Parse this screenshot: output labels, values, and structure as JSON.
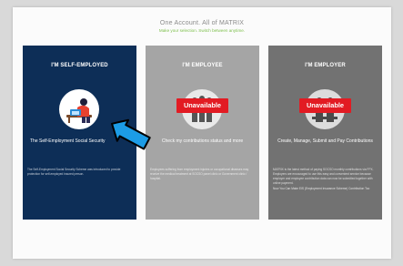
{
  "header": {
    "title": "One Account. All of MATRIX",
    "subtitle": "Make your selection. Switch between anytime."
  },
  "cards": [
    {
      "heading": "I'M SELF-EMPLOYED",
      "title": "The Self-Employment Social Security",
      "body": "The Self-Employment Social Security Scheme was introduced to provide protection for self-employed insured person.",
      "icon": "self-employed-person-icon",
      "available": true,
      "color": "#0d2e57"
    },
    {
      "heading": "I'M EMPLOYEE",
      "badge": "Unavailable",
      "title": "Check my contributions status and more",
      "body": "Employees suffering from employment injuries or occupational diseases may receive the medical treatment at SOCSO panel clinic or Government clinic / hospital.",
      "icon": "employee-group-icon",
      "available": false,
      "color": "#a5a5a5"
    },
    {
      "heading": "I'M EMPLOYER",
      "badge": "Unavailable",
      "title": "Create, Manage, Submit and Pay Contributions",
      "body": "MATRIX is the latest method of paying SOCSO monthly contributions via FPX. Employers are encouraged to use this easy and convenient service because employer and employee contribution data can now be submitted together with online payment.",
      "link": "Now You Can Make EIS (Employment Insurance Scheme) Contribution Too",
      "icon": "employer-group-icon",
      "available": false,
      "color": "#727272"
    }
  ],
  "colors": {
    "accent_green": "#7cbf4a",
    "badge_red": "#e21b23",
    "arrow_blue": "#1c9ce6"
  }
}
